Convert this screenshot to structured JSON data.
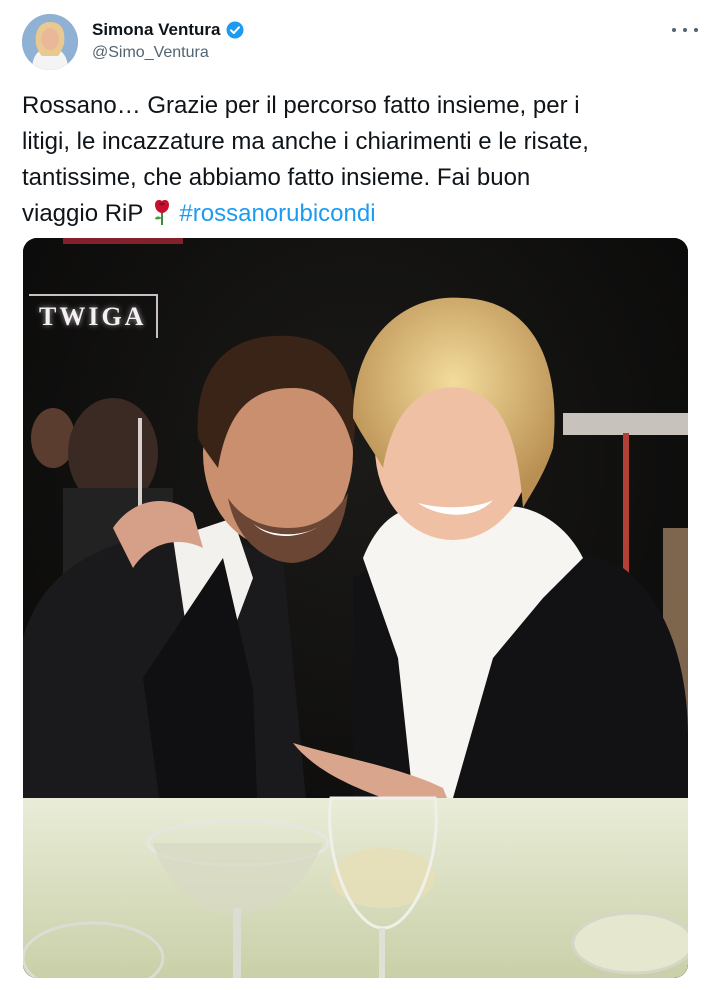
{
  "author": {
    "display_name": "Simona Ventura",
    "handle": "@Simo_Ventura",
    "verified": true
  },
  "tweet": {
    "text_line1": "Rossano… Grazie per il percorso fatto insieme, per i",
    "text_line2": "litigi, le incazzature ma anche i chiarimenti e le risate,",
    "text_line3": "tantissime, che abbiamo fatto insieme. Fai buon",
    "text_line4_prefix": "viaggio RiP",
    "emoji": "rose",
    "hashtag": "#rossanorubicondi"
  },
  "photo": {
    "sign_text": "TWIGA"
  },
  "icons": {
    "more": "more-options-icon",
    "verified": "verified-badge-icon"
  },
  "colors": {
    "link": "#1d9bf0",
    "handle": "#536471",
    "text": "#0f1419"
  }
}
